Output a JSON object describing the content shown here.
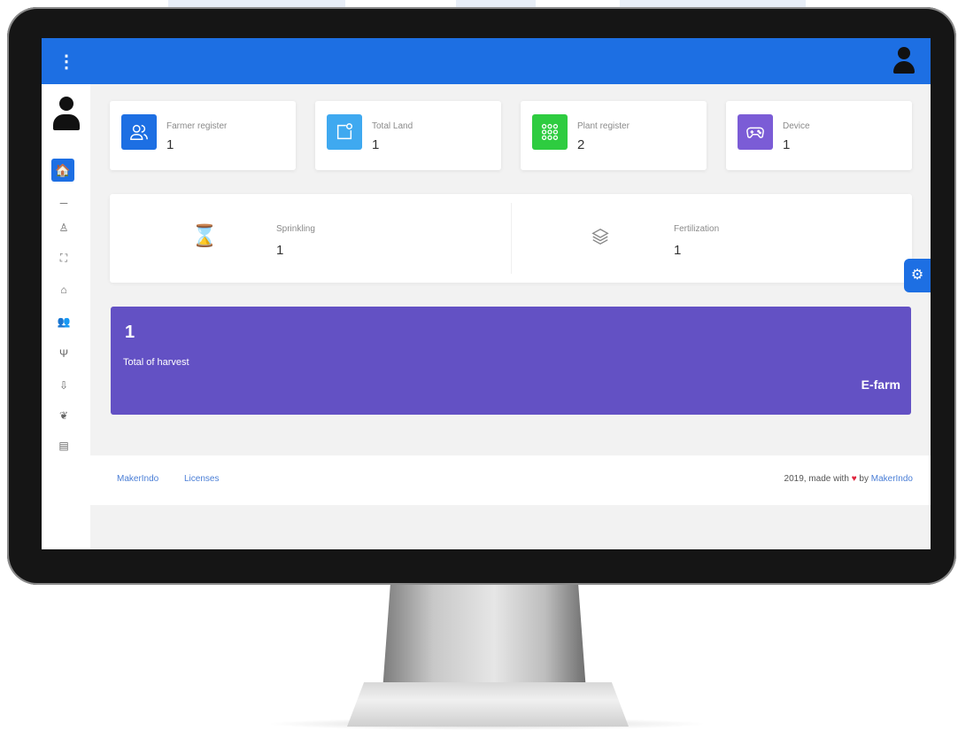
{
  "header": {
    "menu_icon": "more-vertical-icon",
    "user_icon": "user-icon"
  },
  "sidebar": {
    "avatar_icon": "user-icon",
    "items": [
      {
        "icon": "home-icon",
        "glyph": "🏠"
      },
      {
        "icon": "dash-icon",
        "glyph": "─"
      },
      {
        "icon": "farmer-icon",
        "glyph": "♙"
      },
      {
        "icon": "land-icon",
        "glyph": "⛶"
      },
      {
        "icon": "building-icon",
        "glyph": "⌂"
      },
      {
        "icon": "users-icon",
        "glyph": "👥"
      },
      {
        "icon": "plant-icon",
        "glyph": "Ψ"
      },
      {
        "icon": "harvest-icon",
        "glyph": "⇩"
      },
      {
        "icon": "leaf-icon",
        "glyph": "❦"
      },
      {
        "icon": "document-icon",
        "glyph": "▤"
      }
    ]
  },
  "stats": [
    {
      "label": "Farmer register",
      "value": "1",
      "icon": "users-outline-icon",
      "color": "#1d6fe3"
    },
    {
      "label": "Total Land",
      "value": "1",
      "icon": "map-pin-square-icon",
      "color": "#3fa9f0"
    },
    {
      "label": "Plant register",
      "value": "2",
      "icon": "grid-dots-icon",
      "color": "#2ecc40"
    },
    {
      "label": "Device",
      "value": "1",
      "icon": "gamepad-icon",
      "color": "#7b5cd6"
    }
  ],
  "activities": [
    {
      "label": "Sprinkling",
      "value": "1",
      "icon": "hourglass-icon",
      "color": "#e56a5d"
    },
    {
      "label": "Fertilization",
      "value": "1",
      "icon": "layers-icon",
      "color": "#888888"
    }
  ],
  "harvest": {
    "value": "1",
    "label": "Total of harvest",
    "brand": "E-farm",
    "color": "#6351c4"
  },
  "footer": {
    "links": [
      "MakerIndo",
      "Licenses"
    ],
    "copy_prefix": "2019, made with",
    "copy_by": "by",
    "copy_maker": "MakerIndo"
  },
  "settings_icon": "gear-icon"
}
